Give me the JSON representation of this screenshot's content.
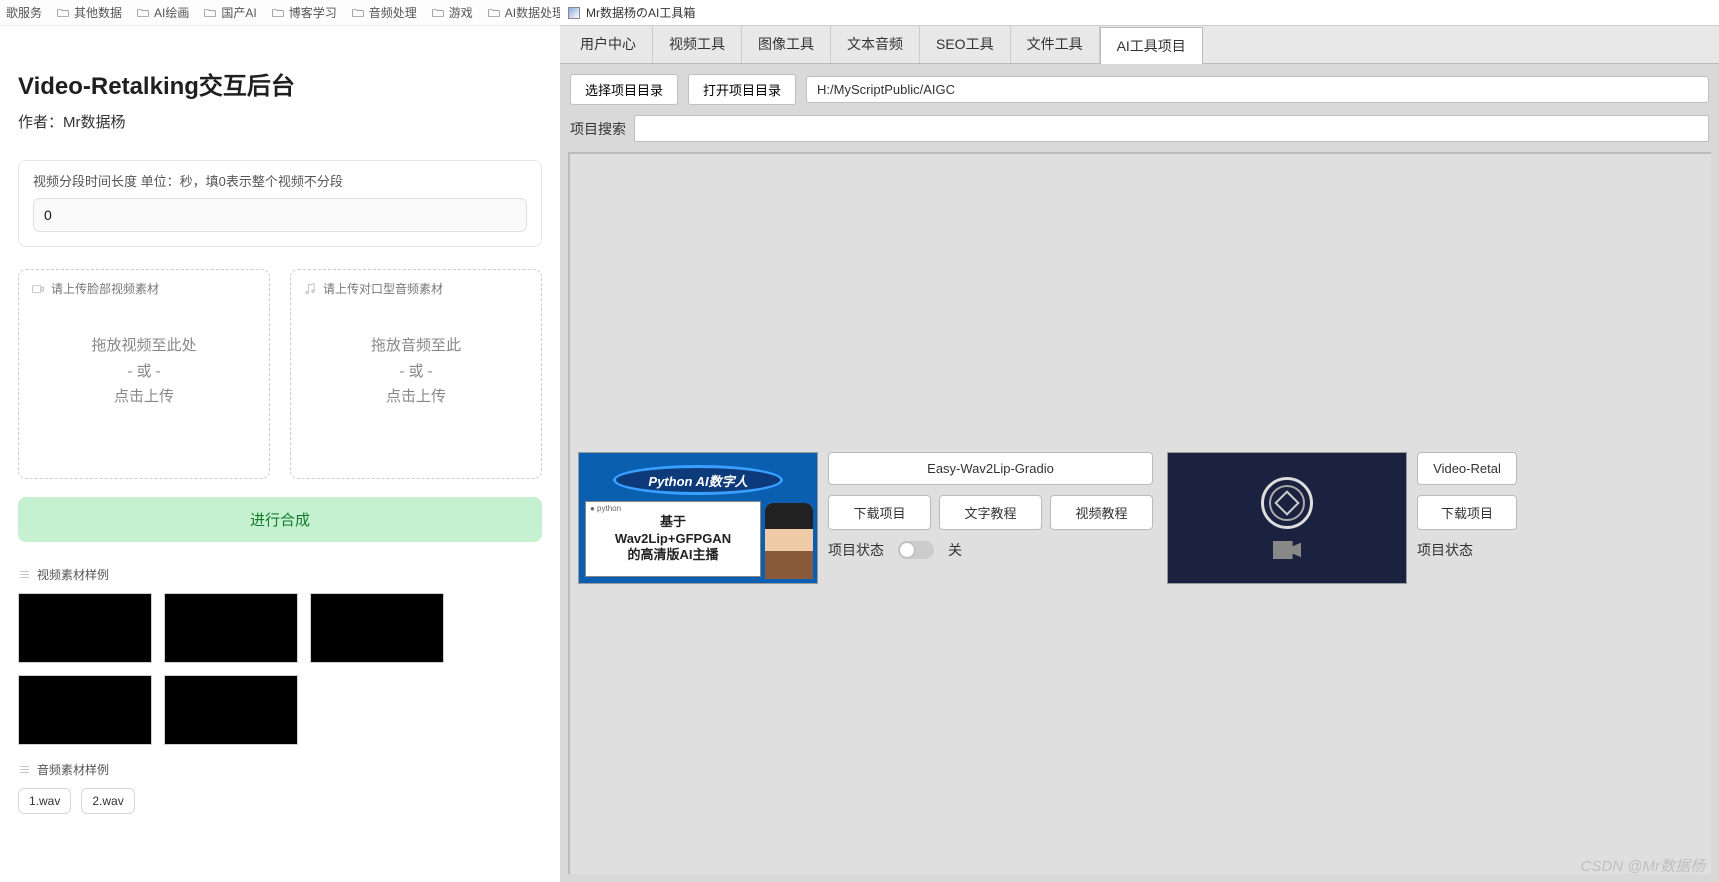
{
  "bookmarks": [
    "歌服务",
    "其他数据",
    "AI绘画",
    "国产AI",
    "博客学习",
    "音频处理",
    "游戏",
    "AI数据处理"
  ],
  "page": {
    "title": "Video-Retalking交互后台",
    "author": "作者：Mr数据杨",
    "seg_label": "视频分段时间长度 单位：秒，填0表示整个视频不分段",
    "seg_value": "0",
    "upload_video_label": "请上传脸部视频素材",
    "upload_audio_label": "请上传对口型音频素材",
    "drop_video_1": "拖放视频至此处",
    "drop_audio_1": "拖放音频至此",
    "drop_or": "- 或 -",
    "drop_click": "点击上传",
    "run_btn": "进行合成",
    "video_samples_label": "视频素材样例",
    "audio_samples_label": "音频素材样例",
    "audio_samples": [
      "1.wav",
      "2.wav"
    ]
  },
  "app": {
    "window_title": "Mr数据杨のAI工具箱",
    "tabs": [
      "用户中心",
      "视频工具",
      "图像工具",
      "文本音频",
      "SEO工具",
      "文件工具",
      "AI工具项目"
    ],
    "active_tab": 6,
    "toolbar": {
      "select_dir": "选择项目目录",
      "open_dir": "打开项目目录",
      "path": "H:/MyScriptPublic/AIGC"
    },
    "search_label": "项目搜索",
    "card1": {
      "thumb_banner": "Python AI数字人",
      "thumb_line1": "基于",
      "thumb_line2": "Wav2Lip+GFPGAN",
      "thumb_line3": "的高清版AI主播",
      "title": "Easy-Wav2Lip-Gradio",
      "btn_download": "下载项目",
      "btn_doc": "文字教程",
      "btn_video": "视频教程",
      "status_label": "项目状态",
      "status_value": "关"
    },
    "card2": {
      "title": "Video-Retal",
      "btn_download": "下载项目",
      "status_label": "项目状态"
    }
  },
  "watermark": "CSDN @Mr数据杨"
}
